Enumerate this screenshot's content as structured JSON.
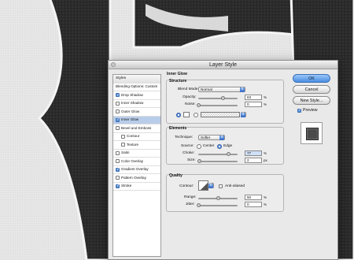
{
  "dialog": {
    "title": "Layer Style"
  },
  "styles_list": {
    "header": "Styles",
    "items": [
      {
        "label": "Blending Options: Custom",
        "checkbox": false,
        "checked": false,
        "indent": false,
        "selected": false
      },
      {
        "label": "Drop Shadow",
        "checkbox": true,
        "checked": true,
        "indent": false,
        "selected": false
      },
      {
        "label": "Inner Shadow",
        "checkbox": true,
        "checked": false,
        "indent": false,
        "selected": false
      },
      {
        "label": "Outer Glow",
        "checkbox": true,
        "checked": false,
        "indent": false,
        "selected": false
      },
      {
        "label": "Inner Glow",
        "checkbox": true,
        "checked": true,
        "indent": false,
        "selected": true
      },
      {
        "label": "Bevel and Emboss",
        "checkbox": true,
        "checked": false,
        "indent": false,
        "selected": false
      },
      {
        "label": "Contour",
        "checkbox": true,
        "checked": false,
        "indent": true,
        "selected": false
      },
      {
        "label": "Texture",
        "checkbox": true,
        "checked": false,
        "indent": true,
        "selected": false
      },
      {
        "label": "Satin",
        "checkbox": true,
        "checked": false,
        "indent": false,
        "selected": false
      },
      {
        "label": "Color Overlay",
        "checkbox": true,
        "checked": false,
        "indent": false,
        "selected": false
      },
      {
        "label": "Gradient Overlay",
        "checkbox": true,
        "checked": true,
        "indent": false,
        "selected": false
      },
      {
        "label": "Pattern Overlay",
        "checkbox": true,
        "checked": false,
        "indent": false,
        "selected": false
      },
      {
        "label": "Stroke",
        "checkbox": true,
        "checked": true,
        "indent": false,
        "selected": false
      }
    ]
  },
  "inner_glow": {
    "title": "Inner Glow",
    "structure": {
      "title": "Structure",
      "blend_mode_label": "Blend Mode:",
      "blend_mode_value": "Normal",
      "opacity_label": "Opacity:",
      "opacity_value": "63",
      "opacity_level": 0.63,
      "noise_label": "Noise:",
      "noise_value": "0",
      "noise_level": 0,
      "unit": "%"
    },
    "elements": {
      "title": "Elements",
      "technique_label": "Technique:",
      "technique_value": "Softer",
      "source_label": "Source:",
      "source_center": "Center",
      "source_edge": "Edge",
      "source_selected": "Edge",
      "choke_label": "Choke:",
      "choke_value": "77",
      "choke_level": 0.77,
      "choke_unit": "%",
      "size_label": "Size:",
      "size_value": "2",
      "size_level": 0.02,
      "size_unit": "px"
    },
    "quality": {
      "title": "Quality",
      "contour_label": "Contour:",
      "anti_aliased_label": "Anti-aliased",
      "anti_aliased_checked": false,
      "range_label": "Range:",
      "range_value": "50",
      "range_level": 0.5,
      "range_unit": "%",
      "jitter_label": "Jitter:",
      "jitter_value": "0",
      "jitter_level": 0,
      "jitter_unit": "%"
    }
  },
  "buttons": {
    "ok": "OK",
    "cancel": "Cancel",
    "new_style": "New Style..."
  },
  "preview": {
    "label": "Preview",
    "checked": true
  },
  "colors": {
    "accent": "#4a8de0",
    "selection": "#b8cde9",
    "glow_swatch": "#ffffff"
  }
}
